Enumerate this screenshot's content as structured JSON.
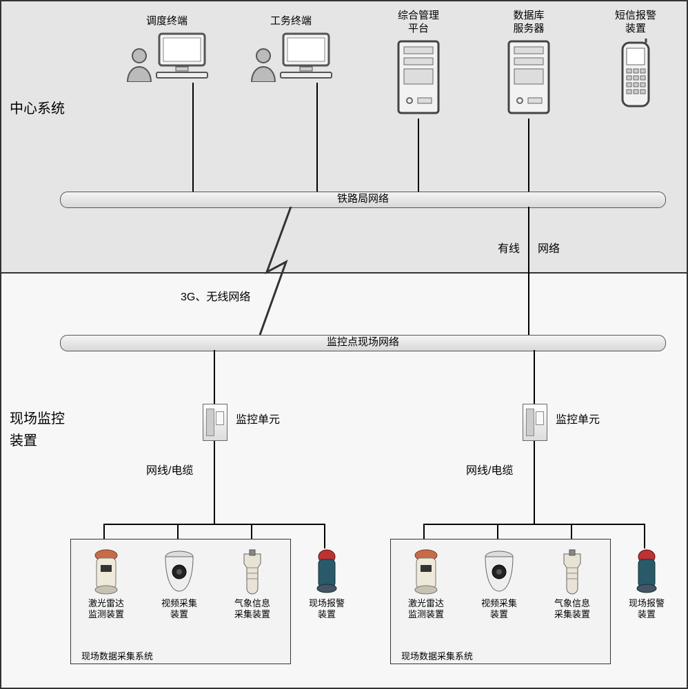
{
  "sections": {
    "center_system": "中心系统",
    "field_device": "现场监控\n装置"
  },
  "top_nodes": {
    "dispatch": "调度终端",
    "work": "工务终端",
    "platform": "综合管理\n平台",
    "db": "数据库\n服务器",
    "sms": "短信报警\n装置"
  },
  "buses": {
    "rail": "铁路局网络",
    "site": "监控点现场网络"
  },
  "links": {
    "wireless": "3G、无线网络",
    "wired_left": "有线",
    "wired_right": "网络"
  },
  "units": {
    "monitor_unit": "监控单元",
    "cable": "网线/电缆",
    "sys_box": "现场数据采集系统"
  },
  "devices": {
    "lidar": "激光雷达\n监测装置",
    "video": "视频采集\n装置",
    "weather": "气象信息\n采集装置",
    "alarm": "现场报警\n装置"
  }
}
